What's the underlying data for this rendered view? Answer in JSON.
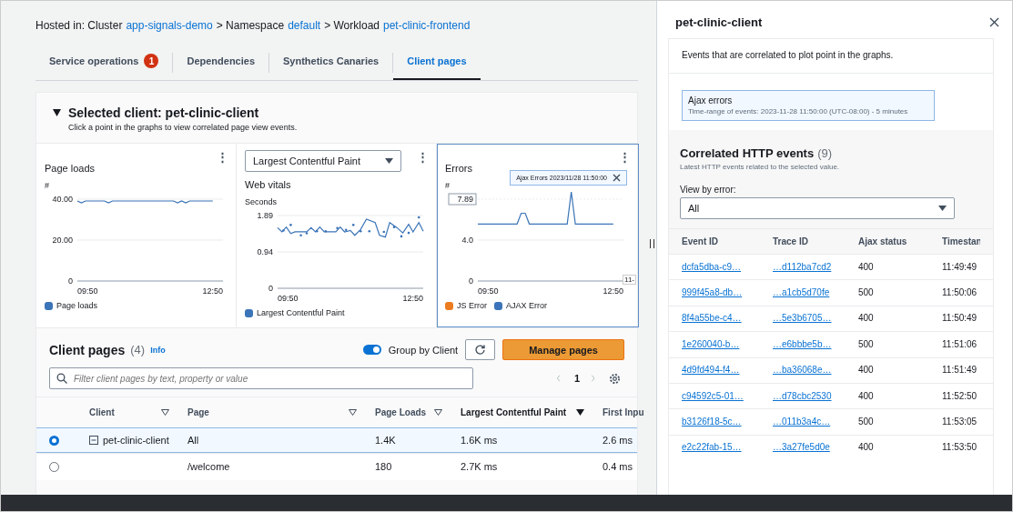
{
  "breadcrumb": {
    "prefix": "Hosted in: Cluster",
    "cluster": "app-signals-demo",
    "sep1": "> Namespace",
    "namespace": "default",
    "sep2": "> Workload",
    "workload": "pet-clinic-frontend"
  },
  "tabs": [
    {
      "label": "Service operations",
      "badge": "1",
      "selected": false
    },
    {
      "label": "Dependencies",
      "selected": false
    },
    {
      "label": "Synthetics Canaries",
      "selected": false
    },
    {
      "label": "Client pages",
      "selected": true
    }
  ],
  "selected_client": {
    "expanded": true,
    "title": "Selected client: pet-clinic-client",
    "subtitle": "Click a point in the graphs to view correlated page view events."
  },
  "charts": [
    {
      "kind": "plain",
      "menu": "⋮",
      "title": "Page loads",
      "unit": "#",
      "selected": false,
      "y_labels": [
        "40.00",
        "20.00",
        "0"
      ],
      "x_labels": [
        "09:50",
        "12:50"
      ],
      "legend": [
        {
          "name": "Page loads",
          "color": "#3b74b8"
        }
      ]
    },
    {
      "kind": "select",
      "menu": "⋮",
      "select": "Largest Contentful Paint",
      "title": "Web vitals",
      "unit": "Seconds",
      "selected": false,
      "y_labels": [
        "1.89",
        "0.94",
        "0"
      ],
      "x_labels": [
        "09:50",
        "12:50"
      ],
      "legend": [
        {
          "name": "Largest Contentful Paint",
          "color": "#3b74b8"
        }
      ]
    },
    {
      "kind": "tooltip",
      "menu": "⋮",
      "title": "Errors",
      "unit": "#",
      "selected": true,
      "tooltip": "Ajax Errors 2023/11/28 11:50:00",
      "cut_label": "11-",
      "y_labels": [
        "7.89",
        "4.0",
        "0"
      ],
      "x_labels": [
        "09:50",
        "12:50"
      ],
      "legend": [
        {
          "name": "JS Error",
          "color": "#ec7c1f"
        },
        {
          "name": "AJAX Error",
          "color": "#3b74b8"
        }
      ]
    }
  ],
  "client_pages": {
    "title": "Client pages",
    "count": "(4)",
    "info": "Info",
    "group_toggle": {
      "label": "Group by Client",
      "on": true
    },
    "manage": "Manage pages",
    "search": {
      "placeholder": "Filter client pages by text, property or value"
    },
    "page": "1",
    "columns": [
      "Client",
      "Page",
      "Page Loads",
      "Largest Contentful Paint",
      "First Inpu"
    ],
    "rows": [
      {
        "selected": true,
        "expanded": true,
        "client": "pet-clinic-client",
        "page": "All",
        "loads": "1.4K",
        "lcp": "1.6K ms",
        "fid": "2.6 ms"
      },
      {
        "selected": false,
        "page": "/welcome",
        "loads": "180",
        "lcp": "2.7K ms",
        "fid": "0.4 ms"
      }
    ]
  },
  "drawer": {
    "title": "pet-clinic-client",
    "description": "Events that are correlated to plot point in the graphs.",
    "selection": {
      "title": "Ajax errors",
      "detail": "Time-range of events: 2023-11-28 11:50:00 (UTC-08:00) - 5 minutes"
    },
    "events_title": "Correlated HTTP events",
    "events_count": "(9)",
    "events_subtitle": "Latest HTTP events related to the selected value.",
    "filter": {
      "label": "View by error:",
      "value": "All"
    },
    "columns": [
      "Event ID",
      "Trace ID",
      "Ajax status",
      "Timestan"
    ],
    "rows": [
      [
        "dcfa5dba-c9…",
        "…d112ba7cd2",
        "400",
        "11:49:49"
      ],
      [
        "999f45a8-db…",
        "…a1cb5d70fe",
        "500",
        "11:50:06"
      ],
      [
        "8f4a55be-c4…",
        "…5e3b6705…",
        "400",
        "11:50:49"
      ],
      [
        "1e260040-b…",
        "…e6bbbe5b…",
        "500",
        "11:51:06"
      ],
      [
        "4d9fd494-f4…",
        "…ba36068e…",
        "400",
        "11:51:49"
      ],
      [
        "c94592c5-01…",
        "…d78cbc2530",
        "400",
        "11:52:50"
      ],
      [
        "b3126f18-5c…",
        "…011b3a4c…",
        "500",
        "11:53:05"
      ],
      [
        "e2c22fab-15…",
        "…3a27fe5d0e",
        "400",
        "11:53:50"
      ]
    ]
  }
}
